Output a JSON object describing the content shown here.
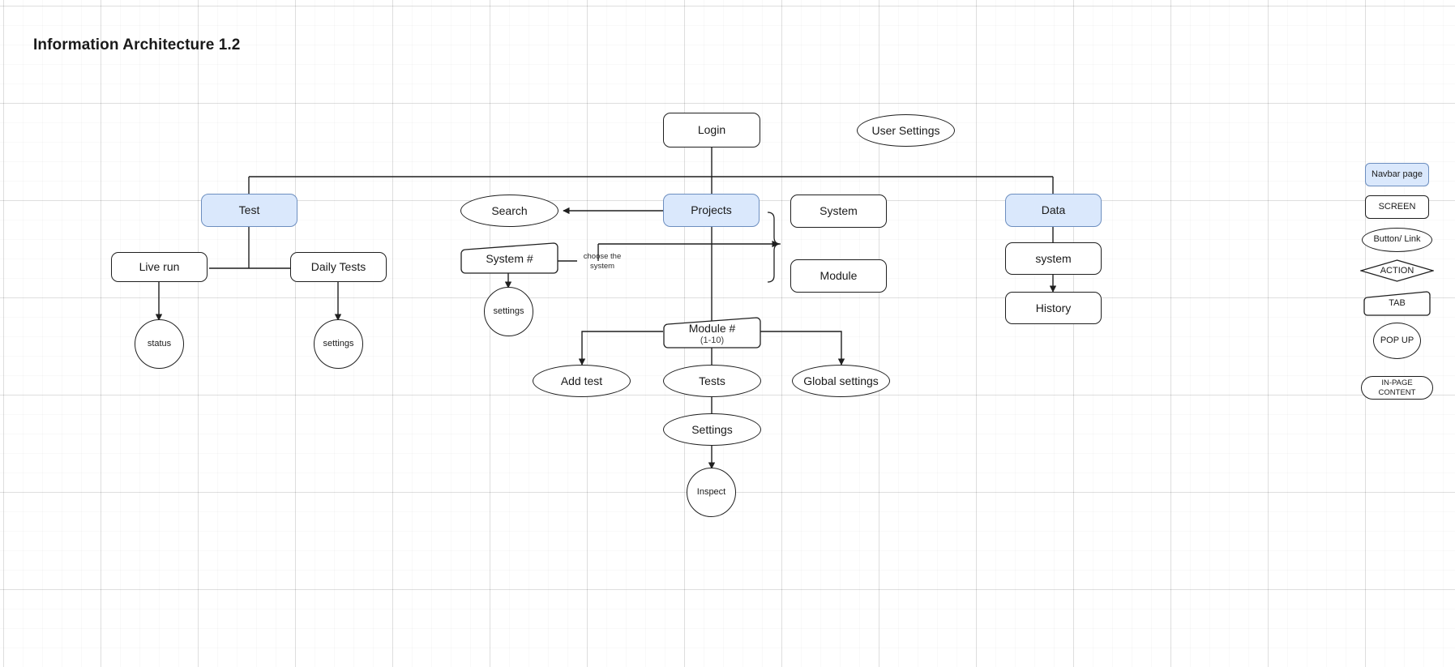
{
  "title": "Information Architecture 1.2",
  "nodes": {
    "login": "Login",
    "user_settings": "User Settings",
    "test": "Test",
    "projects": "Projects",
    "data": "Data",
    "search": "Search",
    "system": "System",
    "module": "Module",
    "live_run": "Live run",
    "daily_tests": "Daily Tests",
    "status": "status",
    "settings_daily": "settings",
    "system_hash": "System #",
    "settings_system": "settings",
    "data_system": "system",
    "history": "History",
    "module_hash": "Module #",
    "module_hash_sub": "(1-10)",
    "add_test": "Add test",
    "tests": "Tests",
    "global_settings": "Global settings",
    "settings_tests": "Settings",
    "inspect": "Inspect"
  },
  "edge_labels": {
    "choose_the_system": "choose the\nsystem",
    "choose_the_system_line1": "choose the",
    "choose_the_system_line2": "system"
  },
  "legend": [
    {
      "key": "navbar",
      "label": "Navbar page"
    },
    {
      "key": "screen",
      "label": "SCREEN"
    },
    {
      "key": "button",
      "label": "Button/ Link"
    },
    {
      "key": "action",
      "label": "ACTION"
    },
    {
      "key": "tab",
      "label": "TAB"
    },
    {
      "key": "popup",
      "label": "POP UP"
    },
    {
      "key": "inpage1",
      "label": "IN-PAGE"
    },
    {
      "key": "inpage2",
      "label": "CONTENT"
    }
  ],
  "colors": {
    "navbar_fill": "#dae8fc",
    "navbar_stroke": "#6c8ebf",
    "node_stroke": "#1f1f1f",
    "node_fill": "#ffffff",
    "edge_stroke": "#1f1f1f",
    "text": "#1a1a1a",
    "grid_minor": "#f2f2f2",
    "grid_major": "#e3e3e3"
  }
}
